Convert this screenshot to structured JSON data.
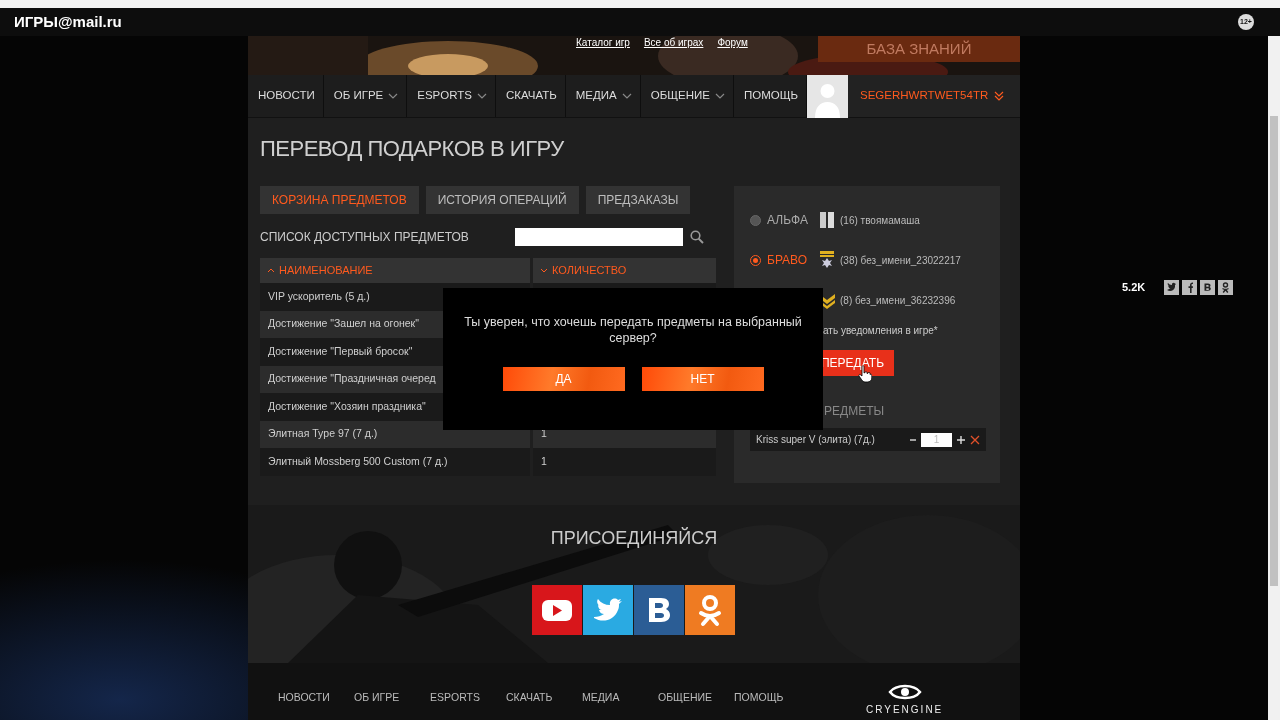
{
  "top_bar": {
    "logo": "ИГРЫ@mail.ru",
    "age_badge": "12+"
  },
  "banner": {
    "links": [
      "Каталог игр",
      "Все об играх",
      "Форум"
    ],
    "button": "БАЗА ЗНАНИЙ"
  },
  "nav": {
    "items": [
      {
        "label": "НОВОСТИ",
        "dropdown": false
      },
      {
        "label": "ОБ ИГРЕ",
        "dropdown": true
      },
      {
        "label": "ESPORTS",
        "dropdown": true
      },
      {
        "label": "СКАЧАТЬ",
        "dropdown": false
      },
      {
        "label": "МЕДИА",
        "dropdown": true
      },
      {
        "label": "ОБЩЕНИЕ",
        "dropdown": true
      },
      {
        "label": "ПОМОЩЬ",
        "dropdown": false
      }
    ],
    "username": "SEGERHWRTWET54TR"
  },
  "page_title": "ПЕРЕВОД ПОДАРКОВ В ИГРУ",
  "tabs": [
    {
      "label": "КОРЗИНА ПРЕДМЕТОВ",
      "selected": true
    },
    {
      "label": "ИСТОРИЯ ОПЕРАЦИЙ",
      "selected": false
    },
    {
      "label": "ПРЕДЗАКАЗЫ",
      "selected": false
    }
  ],
  "list": {
    "title": "СПИСОК ДОСТУПНЫХ ПРЕДМЕТОВ",
    "columns": [
      {
        "label": "НАИМЕНОВАНИЕ",
        "ascending": true
      },
      {
        "label": "КОЛИЧЕСТВО",
        "ascending": false
      }
    ],
    "rows": [
      {
        "name": "VIP ускоритель (5 д.)"
      },
      {
        "name": "Достижение \"Зашел на огонек\""
      },
      {
        "name": "Достижение \"Первый бросок\""
      },
      {
        "name": "Достижение \"Праздничная очеред"
      },
      {
        "name": "Достижение \"Хозяин праздника\""
      },
      {
        "name": "Элитная Type 97 (7 д.)",
        "quantity": "1"
      },
      {
        "name": "Элитный Mossberg 500 Custom (7 д.)",
        "quantity": "1"
      }
    ]
  },
  "servers": [
    {
      "name": "АЛЬФА",
      "selected": false,
      "player": "(16) твоямамаша"
    },
    {
      "name": "БРАВО",
      "selected": true,
      "player": "(38) без_имени_23022217"
    },
    {
      "player": "(8) без_имени_36232396"
    }
  ],
  "notify_label": "ать уведомления в игре*",
  "transfer_button": "ПЕРЕДАТЬ",
  "selected_items": {
    "title": "РЕДМЕТЫ",
    "items": [
      {
        "name": "Kriss super V (элита) (7д.)",
        "quantity": "1"
      }
    ]
  },
  "dialog": {
    "message": "Ты уверен, что хочешь передать предметы на выбранный сервер?",
    "buttons": [
      "ДА",
      "НЕТ"
    ]
  },
  "share": {
    "count": "5.2K"
  },
  "join": {
    "title": "ПРИСОЕДИНЯЙСЯ"
  },
  "footer": {
    "links": [
      "НОВОСТИ",
      "ОБ ИГРЕ",
      "ESPORTS",
      "СКАЧАТЬ",
      "МЕДИА",
      "ОБЩЕНИЕ",
      "ПОМОЩЬ"
    ],
    "engine": "CRYENGINE"
  }
}
